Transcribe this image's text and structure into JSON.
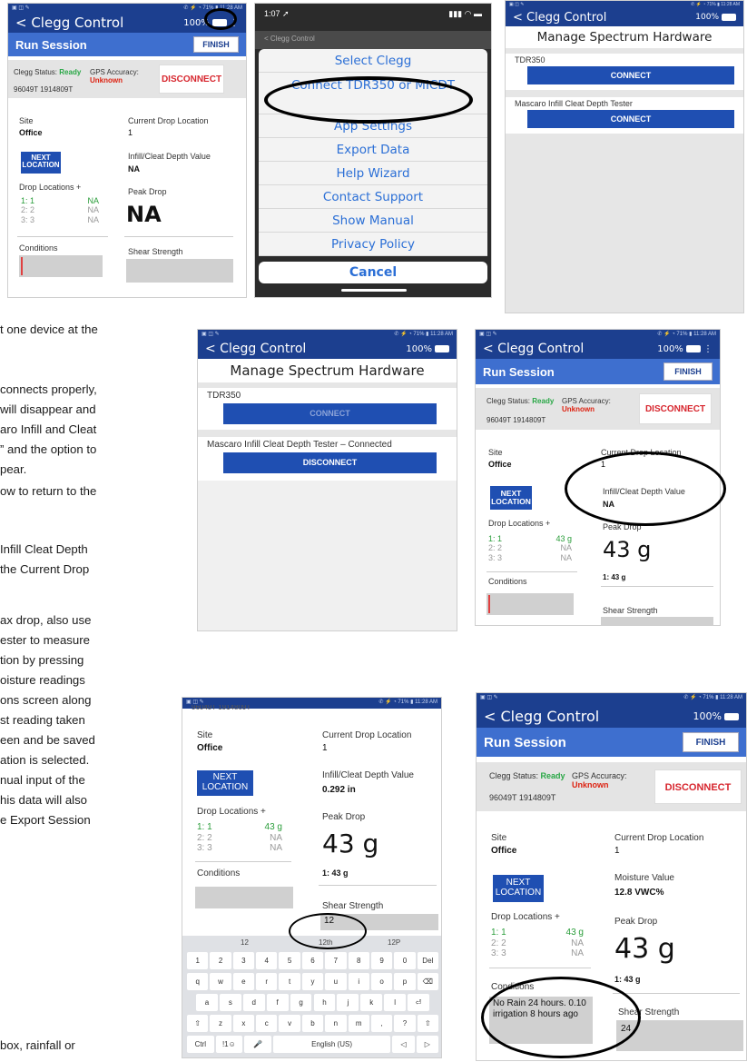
{
  "status_bar": {
    "left": "▣ ◫ ✎",
    "right": "✆ ⚡ ◔ 71% ▮ 11:28 AM"
  },
  "app": {
    "back_label": "< Clegg Control",
    "battery": "100%",
    "run_session": "Run Session",
    "finish": "FINISH",
    "disconnect": "DISCONNECT",
    "connect": "CONNECT"
  },
  "shot1": {
    "battery": "100%",
    "status_label": "Clegg Status:",
    "status_value": "Ready",
    "gps_label": "GPS Accuracy:",
    "gps_value": "Unknown",
    "serial": "96049T 1914809T",
    "site_label": "Site",
    "site_value": "Office",
    "current_label": "Current Drop Location",
    "current_value": "1",
    "next_label": "NEXT LOCATION",
    "infill_label": "Infill/Cleat Depth Value",
    "infill_value": "NA",
    "drop_locations_label": "Drop Locations   +",
    "drops": [
      {
        "loc": "1: 1",
        "val": "NA"
      },
      {
        "loc": "2: 2",
        "val": "NA"
      },
      {
        "loc": "3: 3",
        "val": "NA"
      }
    ],
    "peak_label": "Peak Drop",
    "peak_value": "NA",
    "conditions_label": "Conditions",
    "shear_label": "Shear Strength"
  },
  "shot2": {
    "time": "1:07 ➚",
    "signal": "▮▮▮ ◠ ▬",
    "header": "< Clegg Control",
    "menu": [
      "Select Clegg",
      "Connect TDR350 or MICDT",
      "App Settings",
      "Export Data",
      "Help Wizard",
      "Contact Support",
      "Show Manual",
      "Privacy Policy"
    ],
    "cancel": "Cancel"
  },
  "shot3": {
    "title": "Manage Spectrum Hardware",
    "device1": "TDR350",
    "device2": "Mascaro Infill Cleat Depth Tester",
    "battery": "100%"
  },
  "shot4": {
    "title": "Manage Spectrum Hardware",
    "device1": "TDR350",
    "device2": "Mascaro Infill Cleat Depth Tester – Connected",
    "battery": "100%"
  },
  "shot5": {
    "battery": "100%",
    "status_label": "Clegg Status:",
    "status_value": "Ready",
    "gps_label": "GPS Accuracy:",
    "gps_value": "Unknown",
    "serial": "96049T 1914809T",
    "site_label": "Site",
    "site_value": "Office",
    "current_label": "Current Drop Location",
    "current_value": "1",
    "next_label": "NEXT LOCATION",
    "infill_label": "Infill/Cleat Depth Value",
    "infill_value": "NA",
    "drop_locations_label": "Drop Locations   +",
    "drops": [
      {
        "loc": "1: 1",
        "val": "43 g"
      },
      {
        "loc": "2: 2",
        "val": "NA"
      },
      {
        "loc": "3: 3",
        "val": "NA"
      }
    ],
    "peak_label": "Peak Drop",
    "peak_value": "43 g",
    "peak_sub": "1: 43 g",
    "conditions_label": "Conditions",
    "shear_label": "Shear Strength"
  },
  "shot6": {
    "serial_partial": "96049T 1914809T",
    "site_label": "Site",
    "site_value": "Office",
    "current_label": "Current Drop Location",
    "current_value": "1",
    "next_label": "NEXT LOCATION",
    "infill_label": "Infill/Cleat Depth Value",
    "infill_value": "0.292 in",
    "drop_locations_label": "Drop Locations   +",
    "drops": [
      {
        "loc": "1: 1",
        "val": "43 g"
      },
      {
        "loc": "2: 2",
        "val": "NA"
      },
      {
        "loc": "3: 3",
        "val": "NA"
      }
    ],
    "peak_label": "Peak Drop",
    "peak_value": "43 g",
    "peak_sub": "1: 43 g",
    "conditions_label": "Conditions",
    "shear_label": "Shear Strength",
    "shear_value": "12",
    "suggestions": [
      "12",
      "12th",
      "12P"
    ],
    "row1": [
      "1",
      "2",
      "3",
      "4",
      "5",
      "6",
      "7",
      "8",
      "9",
      "0",
      "Del"
    ],
    "row2": [
      "q",
      "w",
      "e",
      "r",
      "t",
      "y",
      "u",
      "i",
      "o",
      "p",
      "⌫"
    ],
    "row3": [
      "a",
      "s",
      "d",
      "f",
      "g",
      "h",
      "j",
      "k",
      "l",
      "⏎"
    ],
    "row4": [
      "⇧",
      "z",
      "x",
      "c",
      "v",
      "b",
      "n",
      "m",
      ",",
      "?",
      "⇧"
    ],
    "row5": [
      "Ctrl",
      "!1☺",
      "🎤",
      "English (US)",
      "◁",
      "▷"
    ]
  },
  "shot7": {
    "battery": "100%",
    "status_label": "Clegg Status:",
    "status_value": "Ready",
    "gps_label": "GPS Accuracy:",
    "gps_value": "Unknown",
    "serial": "96049T 1914809T",
    "site_label": "Site",
    "site_value": "Office",
    "current_label": "Current Drop Location",
    "current_value": "1",
    "next_label": "NEXT LOCATION",
    "moisture_label": "Moisture Value",
    "moisture_value": "12.8 VWC%",
    "drop_locations_label": "Drop Locations   +",
    "drops": [
      {
        "loc": "1: 1",
        "val": "43 g"
      },
      {
        "loc": "2: 2",
        "val": "NA"
      },
      {
        "loc": "3: 3",
        "val": "NA"
      }
    ],
    "peak_label": "Peak Drop",
    "peak_value": "43 g",
    "peak_sub": "1: 43 g",
    "conditions_label": "Conditions",
    "conditions_value": "No Rain 24 hours. 0.10 irrigation 8 hours ago",
    "shear_label": "Shear Strength",
    "shear_value": "24"
  },
  "text": {
    "p1": [
      "t one device at the"
    ],
    "p2": [
      "connects properly,",
      "will disappear and",
      "aro Infill and Cleat",
      "” and the option to",
      "pear."
    ],
    "p3": [
      "ow to return to the"
    ],
    "p4": [
      "Infill Cleat Depth",
      "the Current Drop"
    ],
    "p5": [
      "ax drop, also use",
      "ester to measure",
      "tion by pressing",
      "oisture readings",
      "ons screen along",
      "st reading taken",
      "een and be saved",
      "ation is selected.",
      "nual input of the",
      "his data will also",
      "e Export Session"
    ],
    "p6": [
      "box, rainfall or"
    ]
  }
}
